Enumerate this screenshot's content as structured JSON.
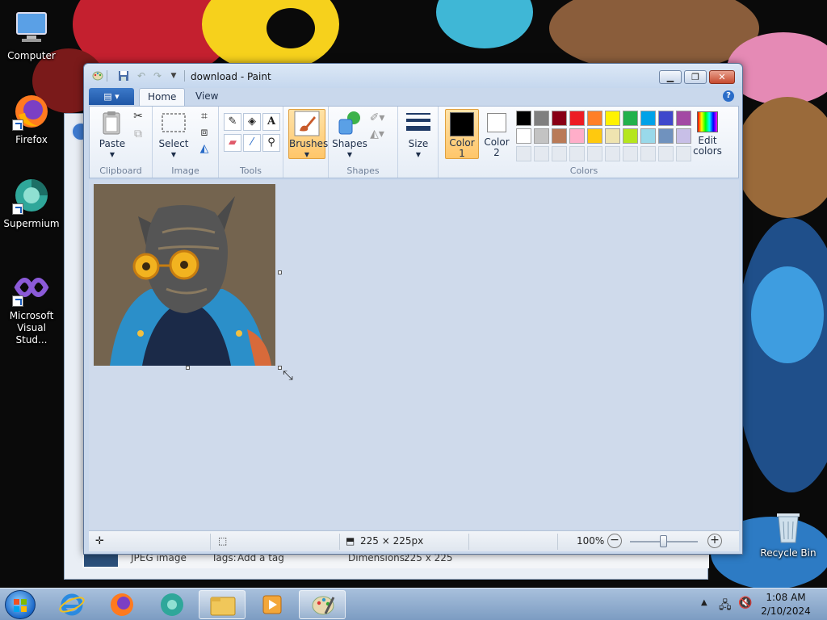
{
  "desktop": {
    "icons": [
      {
        "label": "Computer"
      },
      {
        "label": "Firefox"
      },
      {
        "label": "Supermium"
      },
      {
        "label": "Microsoft Visual Stud..."
      },
      {
        "label": "Recycle Bin"
      }
    ]
  },
  "explorer_status": {
    "type": "JPEG image",
    "tags_label": "Tags:",
    "tags_value": "Add a tag",
    "dimensions_label": "Dimensions:",
    "dimensions_value": "225 x 225"
  },
  "paint": {
    "title": "download - Paint",
    "tabs": [
      "Home",
      "View"
    ],
    "groups": {
      "clipboard": "Clipboard",
      "image": "Image",
      "tools": "Tools",
      "shapes": "Shapes",
      "colors": "Colors"
    },
    "buttons": {
      "paste": "Paste",
      "select": "Select",
      "brushes": "Brushes",
      "shapes": "Shapes",
      "size": "Size",
      "color1_line1": "Color",
      "color1_line2": "1",
      "color2_line1": "Color",
      "color2_line2": "2",
      "edit_colors_line1": "Edit",
      "edit_colors_line2": "colors"
    },
    "palette_row1": [
      "#000000",
      "#7f7f7f",
      "#880015",
      "#ed1c24",
      "#ff7f27",
      "#fff200",
      "#22b14c",
      "#00a2e8",
      "#3f48cc",
      "#a349a4"
    ],
    "palette_row2": [
      "#ffffff",
      "#c3c3c3",
      "#b97a57",
      "#ffaec9",
      "#ffc90e",
      "#efe4b0",
      "#b5e61d",
      "#99d9ea",
      "#7092be",
      "#c8bfe7"
    ],
    "color1": "#000000",
    "color2": "#ffffff",
    "status": {
      "image_size": "225 × 225px",
      "zoom": "100%"
    }
  },
  "taskbar": {
    "time": "1:08 AM",
    "date": "2/10/2024"
  }
}
